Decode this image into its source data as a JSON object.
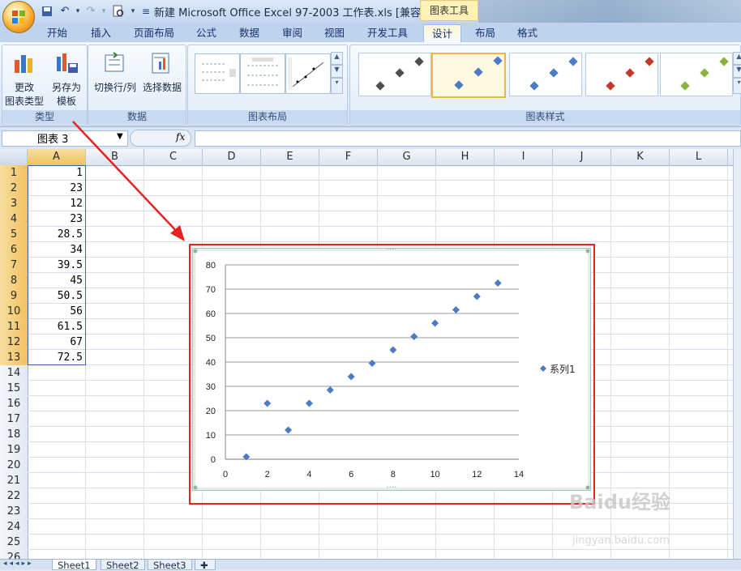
{
  "titlebar": {
    "document_title": "新建 Microsoft Office Excel 97-2003 工作表.xls  [兼容...",
    "context_tab_title": "图表工具",
    "quick_access": [
      "save-icon",
      "undo-icon",
      "redo-icon",
      "print-preview-icon",
      "customize-icon"
    ]
  },
  "ribbon_tabs": [
    {
      "label": "开始"
    },
    {
      "label": "插入"
    },
    {
      "label": "页面布局"
    },
    {
      "label": "公式"
    },
    {
      "label": "数据"
    },
    {
      "label": "审阅"
    },
    {
      "label": "视图"
    },
    {
      "label": "开发工具"
    },
    {
      "label": "设计"
    },
    {
      "label": "布局"
    },
    {
      "label": "格式"
    }
  ],
  "ribbon": {
    "group_type": {
      "label": "类型",
      "change_type_line1": "更改",
      "change_type_line2": "图表类型",
      "save_template_line1": "另存为",
      "save_template_line2": "模板"
    },
    "group_data": {
      "label": "数据",
      "switch_row_col": "切换行/列",
      "select_data": "选择数据"
    },
    "group_layout": {
      "label": "图表布局"
    },
    "group_styles": {
      "label": "图表样式",
      "style_colors": [
        "#4f4f4f",
        "#4a7bc4",
        "#4a7bc4",
        "#c0392b",
        "#8ab43f"
      ]
    }
  },
  "formula_bar": {
    "name_box": "图表 3",
    "fx_label": "fx",
    "formula": ""
  },
  "sheet": {
    "columns": [
      "A",
      "B",
      "C",
      "D",
      "E",
      "F",
      "G",
      "H",
      "I",
      "J",
      "K",
      "L"
    ],
    "rows": [
      "1",
      "2",
      "3",
      "4",
      "5",
      "6",
      "7",
      "8",
      "9",
      "10",
      "11",
      "12",
      "13",
      "14",
      "15",
      "16",
      "17",
      "18",
      "19",
      "20",
      "21",
      "22",
      "23",
      "24",
      "25",
      "26"
    ],
    "column_a_values": [
      "1",
      "23",
      "12",
      "23",
      "28.5",
      "34",
      "39.5",
      "45",
      "50.5",
      "56",
      "61.5",
      "67",
      "72.5"
    ]
  },
  "chart_data": {
    "type": "scatter",
    "series": [
      {
        "name": "系列1",
        "x": [
          1,
          2,
          3,
          4,
          5,
          6,
          7,
          8,
          9,
          10,
          11,
          12,
          13
        ],
        "y": [
          1,
          23,
          12,
          23,
          28.5,
          34,
          39.5,
          45,
          50.5,
          56,
          61.5,
          67,
          72.5
        ],
        "color": "#4a7bc4",
        "marker": "diamond"
      }
    ],
    "xlim": [
      0,
      14
    ],
    "ylim": [
      0,
      80
    ],
    "xticks": [
      0,
      2,
      4,
      6,
      8,
      10,
      12,
      14
    ],
    "yticks": [
      0,
      10,
      20,
      30,
      40,
      50,
      60,
      70,
      80
    ],
    "grid": "horizontal",
    "legend": "right",
    "title": "",
    "xlabel": "",
    "ylabel": ""
  },
  "sheet_tabs": [
    {
      "label": "Sheet1"
    },
    {
      "label": "Sheet2"
    },
    {
      "label": "Sheet3"
    }
  ],
  "watermark": {
    "main": "Baidu经验",
    "sub": "jingyan.baidu.com"
  },
  "colors": {
    "annotation_red": "#e52420",
    "series_blue": "#4a7bc4"
  }
}
